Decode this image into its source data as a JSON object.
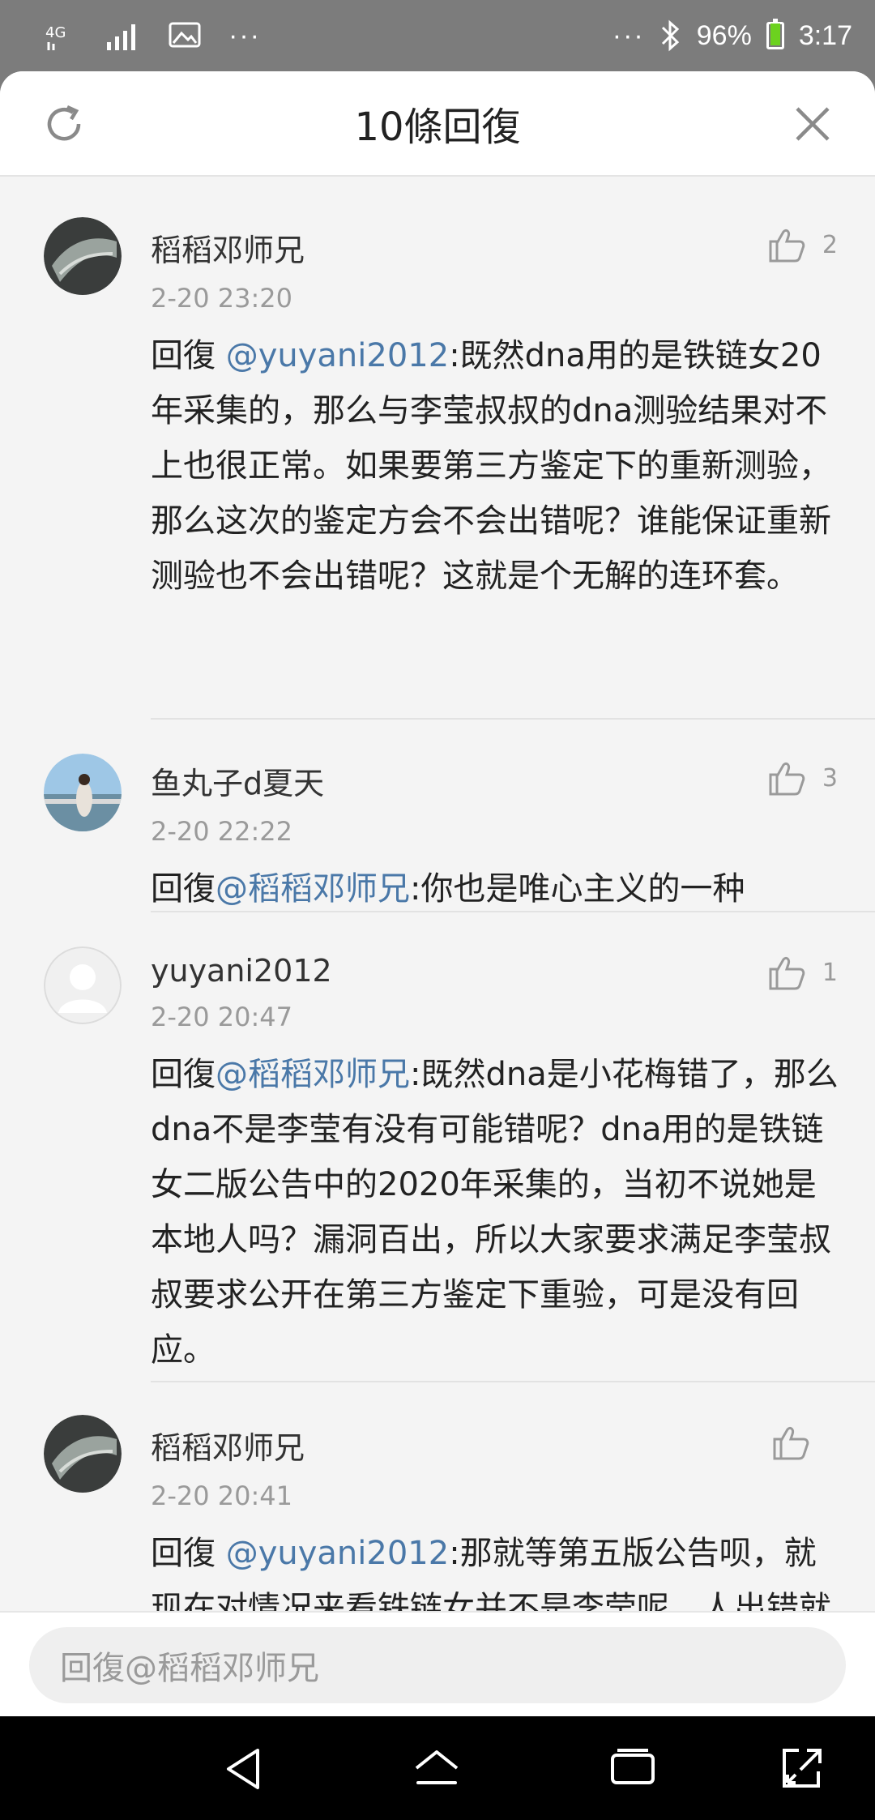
{
  "status_bar": {
    "network": "4G",
    "dots_left": "···",
    "dots_right": "···",
    "battery": "96%",
    "time": "3:17",
    "battery_level": 0.96,
    "battery_color": "#6cd21f"
  },
  "header": {
    "title": "10條回復",
    "refresh_icon": "refresh-icon",
    "close_icon": "close-icon"
  },
  "comments": [
    {
      "author": "稻稻邓师兄",
      "time": "2-20 23:20",
      "likes": "2",
      "prefix": "回復 ",
      "mention": "@yuyani2012",
      "text": ":既然dna用的是铁链女20年采集的，那么与李莹叔叔的dna测验结果对不上也很正常。如果要第三方鉴定下的重新测验，那么这次的鉴定方会不会出错呢？谁能保证重新测验也不会出错呢？这就是个无解的连环套。"
    },
    {
      "author": "鱼丸子d夏天",
      "time": "2-20 22:22",
      "likes": "3",
      "prefix": "回復",
      "mention": "@稻稻邓师兄",
      "text": ":你也是唯心主义的一种"
    },
    {
      "author": "yuyani2012",
      "time": "2-20 20:47",
      "likes": "1",
      "prefix": "回復",
      "mention": "@稻稻邓师兄",
      "text": ":既然dna是小花梅错了，那么dna不是李莹有没有可能错呢？dna用的是铁链女二版公告中的2020年采集的，当初不说她是本地人吗？漏洞百出，所以大家要求满足李莹叔叔要求公开在第三方鉴定下重验，可是没有回应。"
    },
    {
      "author": "稻稻邓师兄",
      "time": "2-20 20:41",
      "likes": "",
      "prefix": "回復 ",
      "mention": "@yuyani2012",
      "text": ":那就等第五版公告呗，就现在对情况来看铁链女并不是李莹呢，人出错就更加证明违心主义的一厢情愿是要不得的。"
    }
  ],
  "reply_bar": {
    "placeholder": "回復@稻稻邓师兄"
  },
  "nav_bar": {
    "back_icon": "back-icon",
    "home_icon": "home-icon",
    "recents_icon": "recents-icon",
    "screenshot_icon": "expand-icon"
  },
  "colors": {
    "mention": "#4a78a8",
    "header_bg": "#ffffff",
    "list_bg": "#f4f4f4"
  }
}
